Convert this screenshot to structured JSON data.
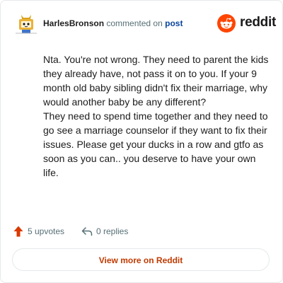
{
  "header": {
    "username": "HarlesBronson",
    "action_text": "commented on",
    "post_link": "post",
    "brand_name": "reddit",
    "brand_color": "#ff4500",
    "avatar_icon": "cartoon-avatar-icon"
  },
  "comment": {
    "paragraphs": [
      "Nta. You're not wrong. They need to parent the kids they already have, not pass it on to you. If your 9 month old baby sibling didn't fix their marriage, why would another baby be any different?",
      "They need to spend time together and they need to go see a marriage counselor if they want to fix their issues. Please get your ducks in a row and gtfo as soon as you can.. you deserve to have your own life."
    ]
  },
  "actions": {
    "upvotes_label": "5 upvotes",
    "upvote_color": "#d93a00",
    "replies_label": "0 replies"
  },
  "footer": {
    "view_more_label": "View more on Reddit",
    "view_more_color": "#c13a00"
  }
}
